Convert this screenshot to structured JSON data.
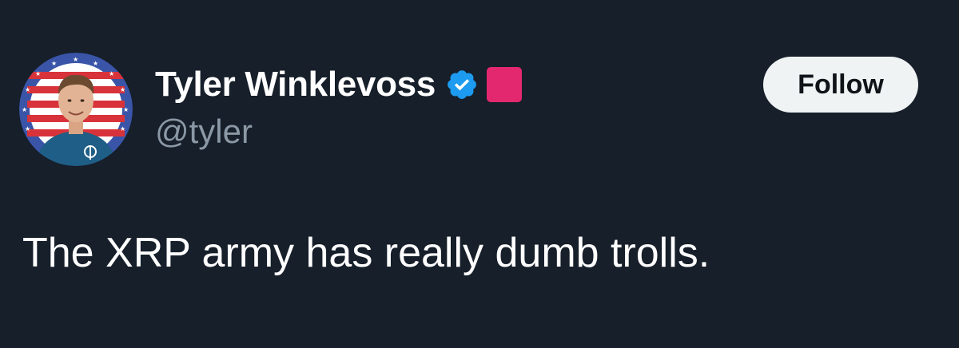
{
  "author": {
    "display_name": "Tyler Winklevoss",
    "handle": "@tyler",
    "verified": true,
    "badge_color": "#e4286f"
  },
  "actions": {
    "follow_label": "Follow"
  },
  "tweet": {
    "text": "The XRP army has really dumb trolls."
  },
  "icons": {
    "verified": "verified-badge-icon",
    "affiliate": "affiliate-badge-icon"
  },
  "colors": {
    "background": "#161f2a",
    "verified_blue": "#1d9bf0",
    "handle_gray": "#8b98a5",
    "follow_button_bg": "#eff3f4"
  }
}
